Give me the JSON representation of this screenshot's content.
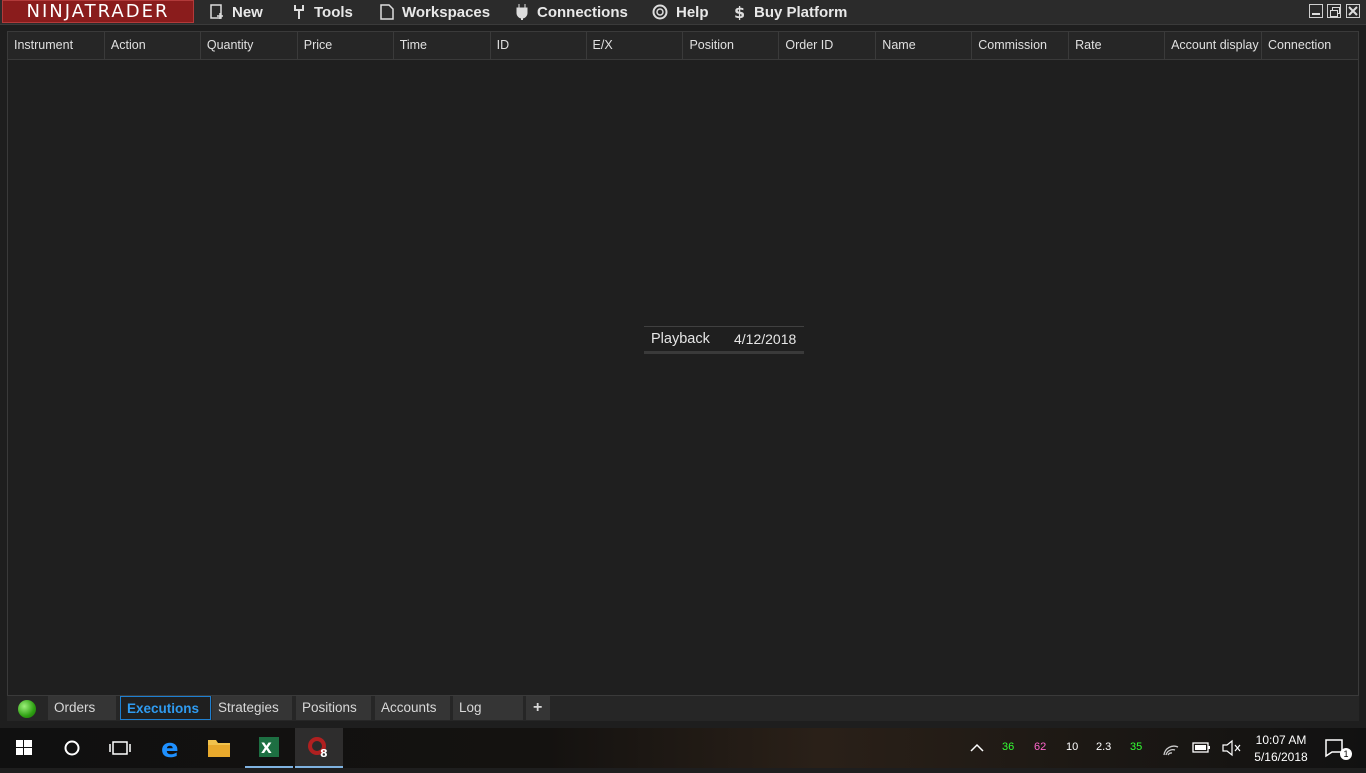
{
  "app": {
    "logo_text": "NINJATRADER"
  },
  "menu": {
    "new": "New",
    "tools": "Tools",
    "workspaces": "Workspaces",
    "connections": "Connections",
    "help": "Help",
    "buy": "Buy Platform"
  },
  "grid": {
    "columns": [
      "Instrument",
      "Action",
      "Quantity",
      "Price",
      "Time",
      "ID",
      "E/X",
      "Position",
      "Order ID",
      "Name",
      "Commission",
      "Rate",
      "Account display",
      "Connection"
    ]
  },
  "playback": {
    "label": "Playback",
    "date": "4/12/2018"
  },
  "tabs": [
    "Orders",
    "Executions",
    "Strategies",
    "Positions",
    "Accounts",
    "Log"
  ],
  "tabs_add": "+",
  "active_tab": "Executions",
  "tray": {
    "values": [
      "36",
      "62",
      "10",
      "2.3",
      "35"
    ],
    "time": "10:07 AM",
    "date": "5/16/2018",
    "notification_count": "1"
  },
  "colors": {
    "brand": "#8a1c1c",
    "accent": "#1e7fd0",
    "status_green": "#2ea012"
  }
}
